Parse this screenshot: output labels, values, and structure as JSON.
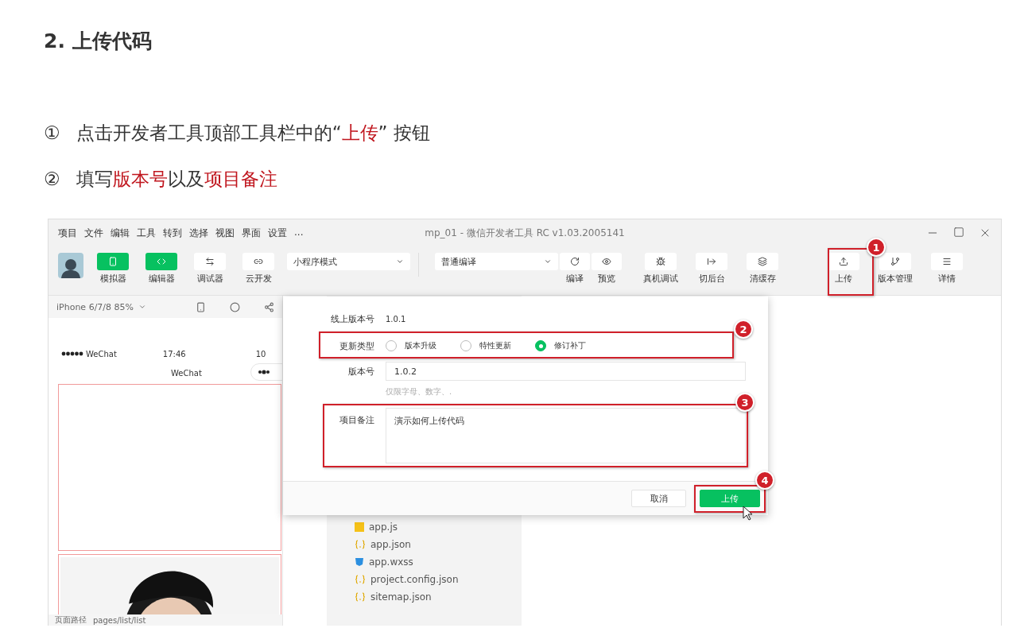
{
  "heading": "2. 上传代码",
  "steps": [
    {
      "marker": "①",
      "parts": [
        {
          "text": "点击开发者工具顶部工具栏中的“",
          "highlight": false
        },
        {
          "text": "上传",
          "highlight": true
        },
        {
          "text": "” 按钮",
          "highlight": false
        }
      ]
    },
    {
      "marker": "②",
      "parts": [
        {
          "text": "填写",
          "highlight": false
        },
        {
          "text": "版本号",
          "highlight": true
        },
        {
          "text": "以及",
          "highlight": false
        },
        {
          "text": "项目备注",
          "highlight": true
        }
      ]
    }
  ],
  "window": {
    "menu": [
      "项目",
      "文件",
      "编辑",
      "工具",
      "转到",
      "选择",
      "视图",
      "界面",
      "设置",
      "..."
    ],
    "title": "mp_01 - 微信开发者工具 RC v1.03.2005141",
    "toolbar": {
      "views": [
        {
          "label": "模拟器",
          "on": true
        },
        {
          "label": "编辑器",
          "on": true
        },
        {
          "label": "调试器",
          "on": false
        },
        {
          "label": "云开发",
          "on": false
        }
      ],
      "mode": "小程序模式",
      "compile": "普通编译",
      "compile_tools": [
        "编译",
        "预览"
      ],
      "tools": [
        "真机调试",
        "切后台",
        "清缓存"
      ],
      "publish": [
        "上传",
        "版本管理",
        "详情"
      ]
    },
    "simulator": {
      "device": "iPhone 6/7/8 85%",
      "carrier": "WeChat",
      "time": "17:46",
      "battery": "10",
      "nav_title": "WeChat",
      "path_label": "页面路径",
      "path": "pages/list/list"
    },
    "files": [
      {
        "name": "app.js",
        "kind": "js"
      },
      {
        "name": "app.json",
        "kind": "json"
      },
      {
        "name": "app.wxss",
        "kind": "wxss"
      },
      {
        "name": "project.config.json",
        "kind": "json"
      },
      {
        "name": "sitemap.json",
        "kind": "json"
      }
    ],
    "dialog": {
      "online_version": {
        "label": "线上版本号",
        "value": "1.0.1"
      },
      "update_type": {
        "label": "更新类型",
        "options": [
          {
            "label": "版本升级",
            "selected": false
          },
          {
            "label": "特性更新",
            "selected": false
          },
          {
            "label": "修订补丁",
            "selected": true
          }
        ]
      },
      "version": {
        "label": "版本号",
        "value": "1.0.2",
        "hint": "仅限字母、数字、."
      },
      "note": {
        "label": "项目备注",
        "value": "演示如何上传代码"
      },
      "buttons": [
        {
          "label": "取消",
          "kind": "secondary"
        },
        {
          "label": "上传",
          "kind": "primary"
        }
      ]
    },
    "annotations": [
      "1",
      "2",
      "3",
      "4"
    ]
  }
}
